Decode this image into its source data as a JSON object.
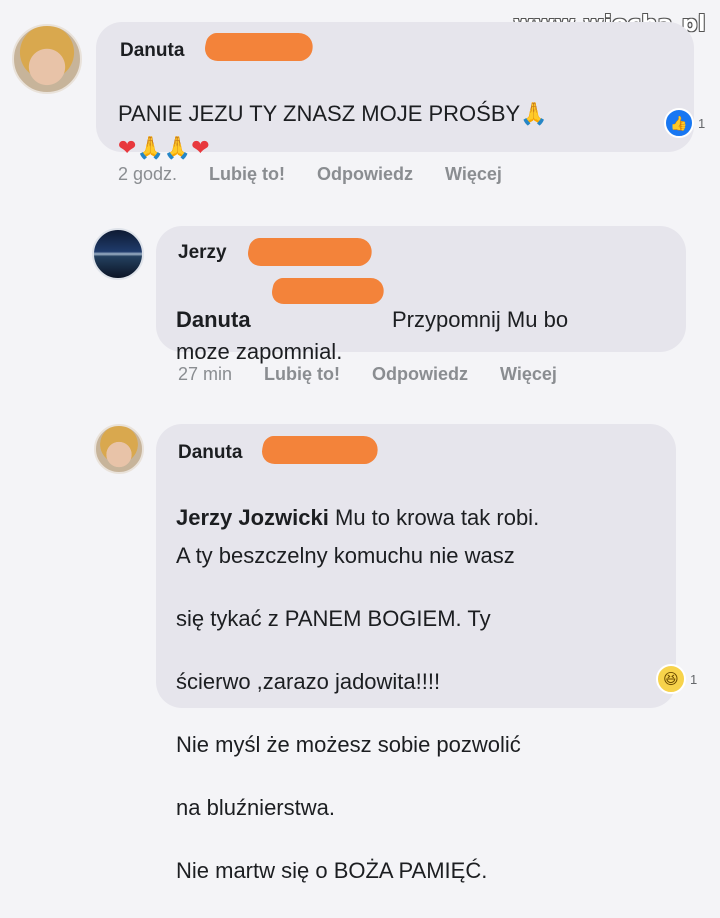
{
  "watermark": "www.wiocha.pl",
  "comments": [
    {
      "author": "Danuta",
      "text_line1": "PANIE JEZU TY ZNASZ MOJE PROŚBY",
      "emoji_pray_1": "🙏",
      "emoji_line2": [
        "❤",
        "🙏",
        "🙏",
        "❤"
      ],
      "reaction_icon": "like-icon",
      "reaction_count": "1",
      "time": "2 godz.",
      "actions": [
        "Lubię to!",
        "Odpowiedz",
        "Więcej"
      ]
    },
    {
      "author": "Jerzy",
      "mention": "Danuta",
      "text_line1": "Przypomnij Mu bo",
      "text_line2": "moze zapomnial.",
      "time": "27 min",
      "actions": [
        "Lubię to!",
        "Odpowiedz",
        "Więcej"
      ]
    },
    {
      "author": "Danuta",
      "mention": "Jerzy Jozwicki",
      "text_line1_rest": " Mu to krowa tak robi.",
      "lines": [
        "A ty beszczelny komuchu nie wasz",
        "się tykać z PANEM BOGIEM. Ty",
        "ścierwo ,zarazo jadowita!!!!",
        "Nie myśl że możesz sobie pozwolić",
        "na bluźnierstwa.",
        "Nie martw się o BOŻA PAMIĘĆ."
      ],
      "reaction_icon": "haha-icon",
      "reaction_count": "1"
    }
  ],
  "colors": {
    "bubble": "#e6e5ec",
    "background": "#f4f4f7",
    "redaction": "#f3833a",
    "meta_text": "#8a8d91"
  }
}
